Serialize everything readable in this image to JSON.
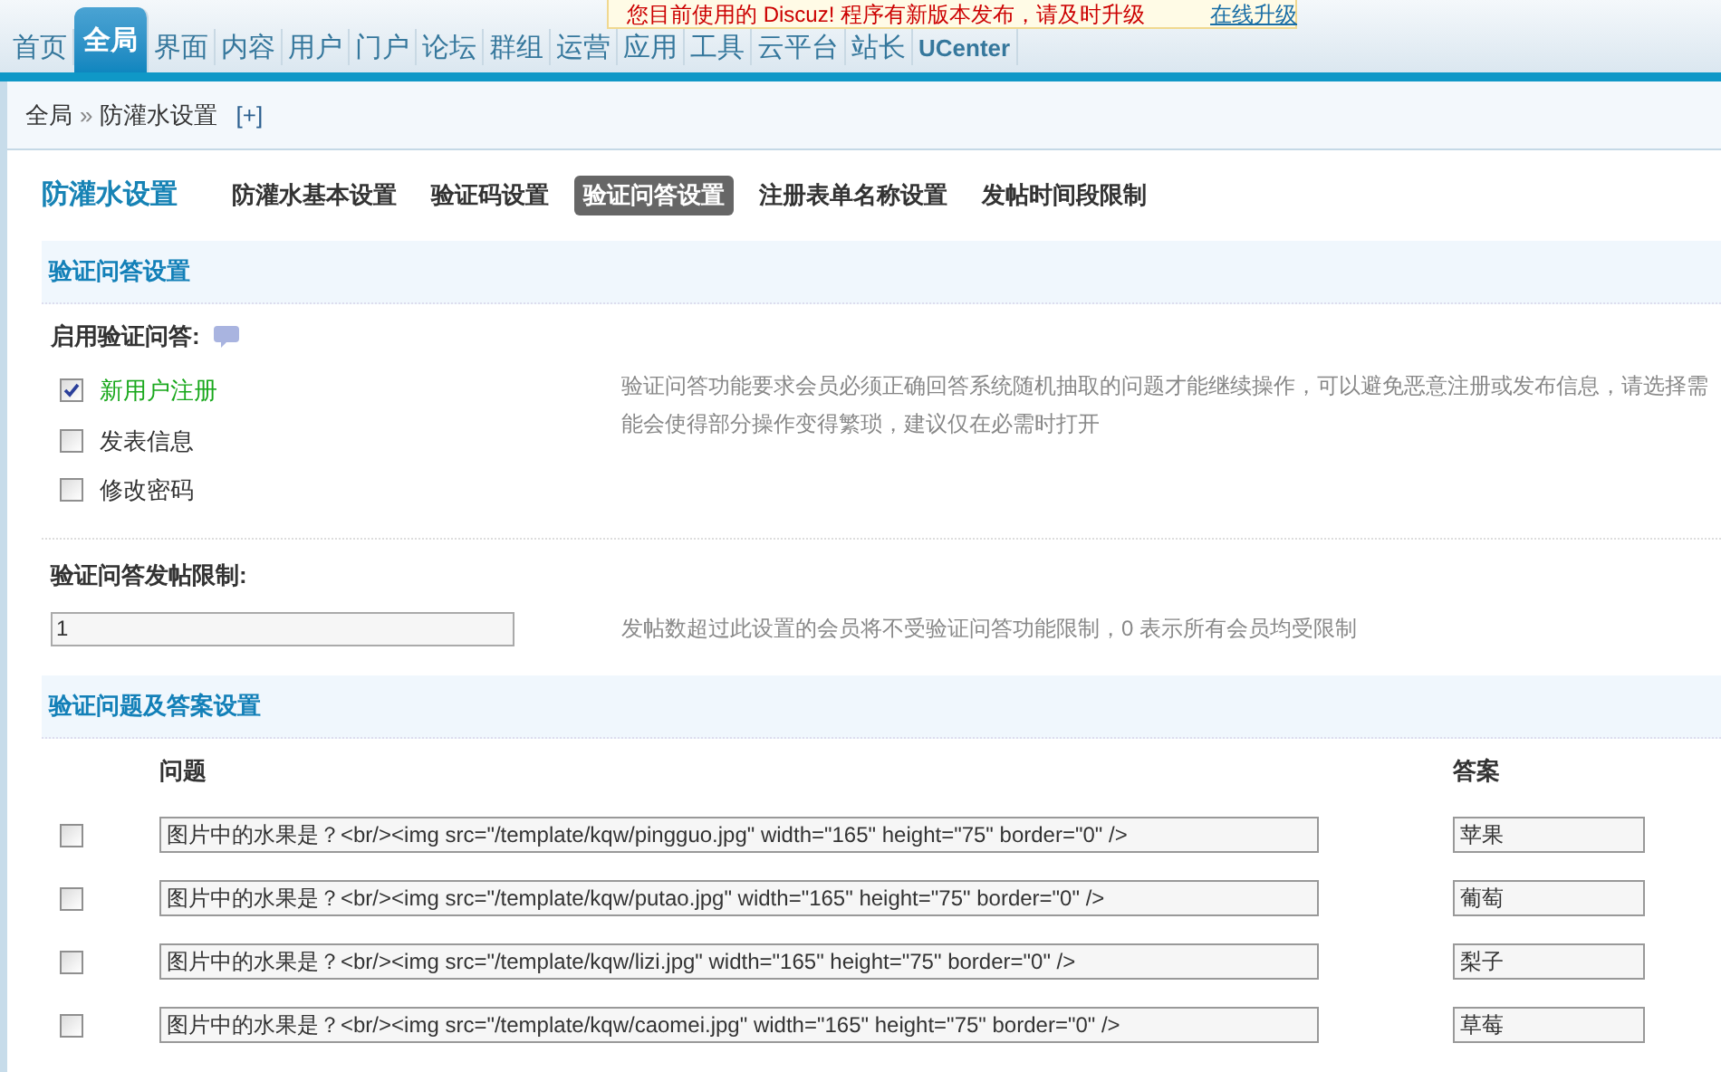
{
  "notice": {
    "text": "您目前使用的 Discuz! 程序有新版本发布，请及时升级",
    "link": "在线升级"
  },
  "nav": [
    {
      "label": "首页",
      "selected": false
    },
    {
      "label": "全局",
      "selected": true
    },
    {
      "label": "界面",
      "selected": false
    },
    {
      "label": "内容",
      "selected": false
    },
    {
      "label": "用户",
      "selected": false
    },
    {
      "label": "门户",
      "selected": false
    },
    {
      "label": "论坛",
      "selected": false
    },
    {
      "label": "群组",
      "selected": false
    },
    {
      "label": "运营",
      "selected": false
    },
    {
      "label": "应用",
      "selected": false
    },
    {
      "label": "工具",
      "selected": false
    },
    {
      "label": "云平台",
      "selected": false
    },
    {
      "label": "站长",
      "selected": false
    },
    {
      "label": "UCenter",
      "selected": false
    }
  ],
  "breadcrumb": {
    "parent": "全局",
    "separator": "»",
    "current": "防灌水设置",
    "add": "[+]"
  },
  "page_title": "防灌水设置",
  "tabs": [
    {
      "label": "防灌水基本设置",
      "selected": false
    },
    {
      "label": "验证码设置",
      "selected": false
    },
    {
      "label": "验证问答设置",
      "selected": true
    },
    {
      "label": "注册表单名称设置",
      "selected": false
    },
    {
      "label": "发帖时间段限制",
      "selected": false
    }
  ],
  "section1": {
    "title": "验证问答设置",
    "enable_label": "启用验证问答:",
    "options": [
      {
        "label": "新用户注册",
        "checked": true
      },
      {
        "label": "发表信息",
        "checked": false
      },
      {
        "label": "修改密码",
        "checked": false
      }
    ],
    "description": [
      "验证问答功能要求会员必须正确回答系统随机抽取的问题才能继续操作，可以避免恶意注册或发布信息，请选择需",
      "能会使得部分操作变得繁琐，建议仅在必需时打开"
    ],
    "limit_label": "验证问答发帖限制:",
    "limit_value": "1",
    "limit_hint": "发帖数超过此设置的会员将不受验证问答功能限制，0 表示所有会员均受限制"
  },
  "section2": {
    "title": "验证问题及答案设置",
    "columns": [
      "问题",
      "答案"
    ],
    "rows": [
      {
        "checked": false,
        "question": "图片中的水果是？<br/><img src=\"/template/kqw/pingguo.jpg\" width=\"165\" height=\"75\" border=\"0\" />",
        "answer": "苹果"
      },
      {
        "checked": false,
        "question": "图片中的水果是？<br/><img src=\"/template/kqw/putao.jpg\" width=\"165\" height=\"75\" border=\"0\" />",
        "answer": "葡萄"
      },
      {
        "checked": false,
        "question": "图片中的水果是？<br/><img src=\"/template/kqw/lizi.jpg\" width=\"165\" height=\"75\" border=\"0\" />",
        "answer": "梨子"
      },
      {
        "checked": false,
        "question": "图片中的水果是？<br/><img src=\"/template/kqw/caomei.jpg\" width=\"165\" height=\"75\" border=\"0\" />",
        "answer": "草莓"
      }
    ]
  }
}
